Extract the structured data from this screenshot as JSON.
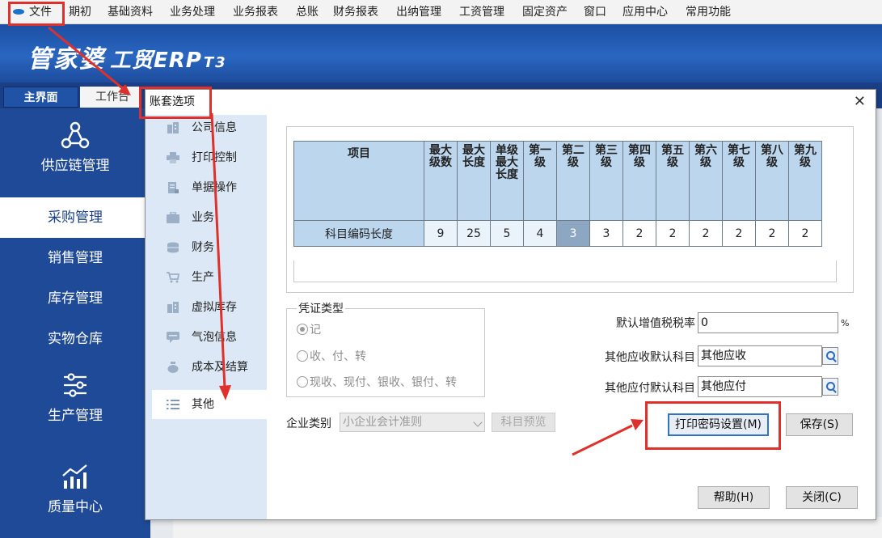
{
  "menubar": {
    "items": [
      "文件",
      "期初",
      "基础资料",
      "业务处理",
      "业务报表",
      "总账",
      "财务报表",
      "出纳管理",
      "工资管理",
      "固定资产",
      "窗口",
      "应用中心",
      "常用功能"
    ]
  },
  "banner": {
    "brand": "管家婆",
    "product": "工贸ERP",
    "edition": "T3"
  },
  "tabs": {
    "main": "主界面",
    "work": "工作台"
  },
  "sidebar": {
    "items": [
      {
        "label": "供应链管理",
        "icon": "network-icon"
      },
      {
        "label": "采购管理",
        "selected": true
      },
      {
        "label": "销售管理"
      },
      {
        "label": "库存管理"
      },
      {
        "label": "实物仓库"
      },
      {
        "label": "生产管理",
        "icon": "sliders-icon"
      },
      {
        "label": "质量中心",
        "icon": "chart-icon"
      }
    ]
  },
  "dialog": {
    "title": "账套选项",
    "nav": [
      {
        "label": "公司信息",
        "icon": "building-icon"
      },
      {
        "label": "打印控制",
        "icon": "printer-icon"
      },
      {
        "label": "单据操作",
        "icon": "document-icon"
      },
      {
        "label": "业务",
        "icon": "briefcase-icon"
      },
      {
        "label": "财务",
        "icon": "database-icon"
      },
      {
        "label": "生产",
        "icon": "cart-icon"
      },
      {
        "label": "虚拟库存",
        "icon": "building-icon"
      },
      {
        "label": "气泡信息",
        "icon": "speech-bubble-icon"
      },
      {
        "label": "成本及结算",
        "icon": "money-bag-icon"
      },
      {
        "label": "其他",
        "icon": "list-icon",
        "selected": true
      }
    ],
    "grid": {
      "headers": [
        "项目",
        "最大级数",
        "最大长度",
        "单级最大长度",
        "第一级",
        "第二级",
        "第三级",
        "第四级",
        "第五级",
        "第六级",
        "第七级",
        "第八级",
        "第九级"
      ],
      "row": [
        "科目编码长度",
        "9",
        "25",
        "5",
        "4",
        "3",
        "3",
        "2",
        "2",
        "2",
        "2",
        "2",
        "2"
      ],
      "current_cell_index": 5
    },
    "voucher_group": {
      "label": "凭证类型",
      "options": [
        "记",
        "收、付、转",
        "现收、现付、银收、银付、转"
      ],
      "selected_index": 0
    },
    "fields": {
      "vat_label": "默认增值税税率",
      "vat_value": "0",
      "vat_unit": "%",
      "receivable_label": "其他应收默认科目",
      "receivable_value": "其他应收",
      "payable_label": "其他应付默认科目",
      "payable_value": "其他应付"
    },
    "enterprise": {
      "label": "企业类别",
      "value": "小企业会计准则",
      "preview_button": "科目预览"
    },
    "buttons": {
      "print_password": "打印密码设置(M)",
      "save": "保存(S)",
      "help": "帮助(H)",
      "close": "关闭(C)"
    }
  },
  "colors": {
    "sidebar_bg": "#1f4a97",
    "banner_bg": "#2a66c0",
    "grid_header_bg": "#bcd6ee",
    "annotation_red": "#e0302b"
  }
}
